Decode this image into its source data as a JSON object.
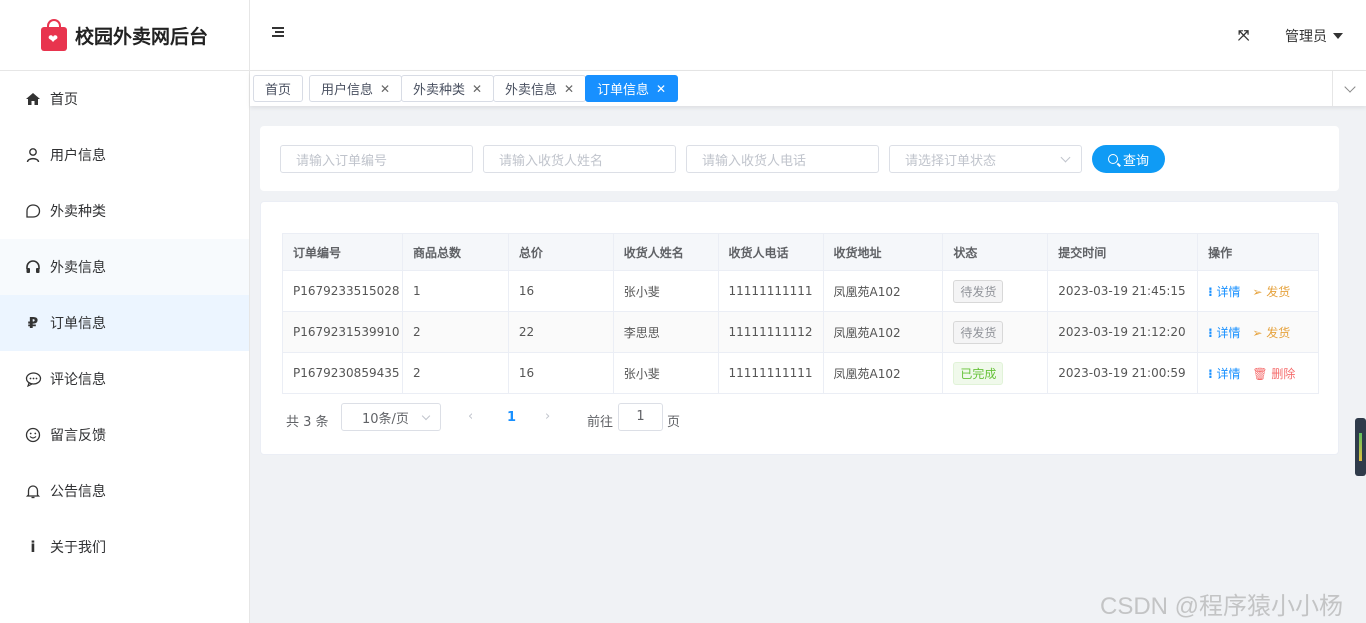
{
  "app": {
    "title": "校园外卖网后台"
  },
  "sidebar": {
    "items": [
      {
        "label": "首页",
        "icon": "home-icon"
      },
      {
        "label": "用户信息",
        "icon": "user-icon"
      },
      {
        "label": "外卖种类",
        "icon": "chat-bubble-icon"
      },
      {
        "label": "外卖信息",
        "icon": "headphones-icon"
      },
      {
        "label": "订单信息",
        "icon": "ruble-icon"
      },
      {
        "label": "评论信息",
        "icon": "comment-icon"
      },
      {
        "label": "留言反馈",
        "icon": "smile-icon"
      },
      {
        "label": "公告信息",
        "icon": "bell-icon"
      },
      {
        "label": "关于我们",
        "icon": "info-icon"
      }
    ],
    "active_index": 4
  },
  "header": {
    "collapse_icon": "menu-fold-icon",
    "fullscreen_icon": "fullscreen-icon",
    "fullscreen_glyph": "⤧",
    "user_label": "管理员"
  },
  "tabs": [
    {
      "label": "首页",
      "closable": false
    },
    {
      "label": "用户信息",
      "closable": true
    },
    {
      "label": "外卖种类",
      "closable": true
    },
    {
      "label": "外卖信息",
      "closable": true
    },
    {
      "label": "订单信息",
      "closable": true,
      "active": true
    }
  ],
  "search": {
    "order_no_placeholder": "请输入订单编号",
    "name_placeholder": "请输入收货人姓名",
    "phone_placeholder": "请输入收货人电话",
    "status_placeholder": "请选择订单状态",
    "query_label": "查询"
  },
  "table": {
    "columns": [
      "订单编号",
      "商品总数",
      "总价",
      "收货人姓名",
      "收货人电话",
      "收货地址",
      "状态",
      "提交时间",
      "操作"
    ],
    "rows": [
      {
        "order_no": "P1679233515028",
        "count": "1",
        "price": "16",
        "name": "张小斐",
        "phone": "11111111111",
        "address": "凤凰苑A102",
        "status": "待发货",
        "time": "2023-03-19 21:45:15",
        "action1": "详情",
        "action2": "发货"
      },
      {
        "order_no": "P1679231539910",
        "count": "2",
        "price": "22",
        "name": "李思思",
        "phone": "11111111112",
        "address": "凤凰苑A102",
        "status": "待发货",
        "time": "2023-03-19 21:12:20",
        "action1": "详情",
        "action2": "发货"
      },
      {
        "order_no": "P1679230859435",
        "count": "2",
        "price": "16",
        "name": "张小斐",
        "phone": "11111111111",
        "address": "凤凰苑A102",
        "status": "已完成",
        "time": "2023-03-19 21:00:59",
        "action1": "详情",
        "action2": "删除"
      }
    ]
  },
  "pagination": {
    "total": "共 3 条",
    "page_size": "10条/页",
    "current_page": "1",
    "goto_label": "前往",
    "goto_value": "1",
    "goto_unit": "页"
  },
  "watermark": "CSDN @程序猿小小杨",
  "colors": {
    "accent": "#1890ff",
    "query_button": "#0f9bf5",
    "logo": "#e8344e",
    "done": "#67c23a",
    "ship": "#e6a23c",
    "delete": "#f56c6c"
  }
}
